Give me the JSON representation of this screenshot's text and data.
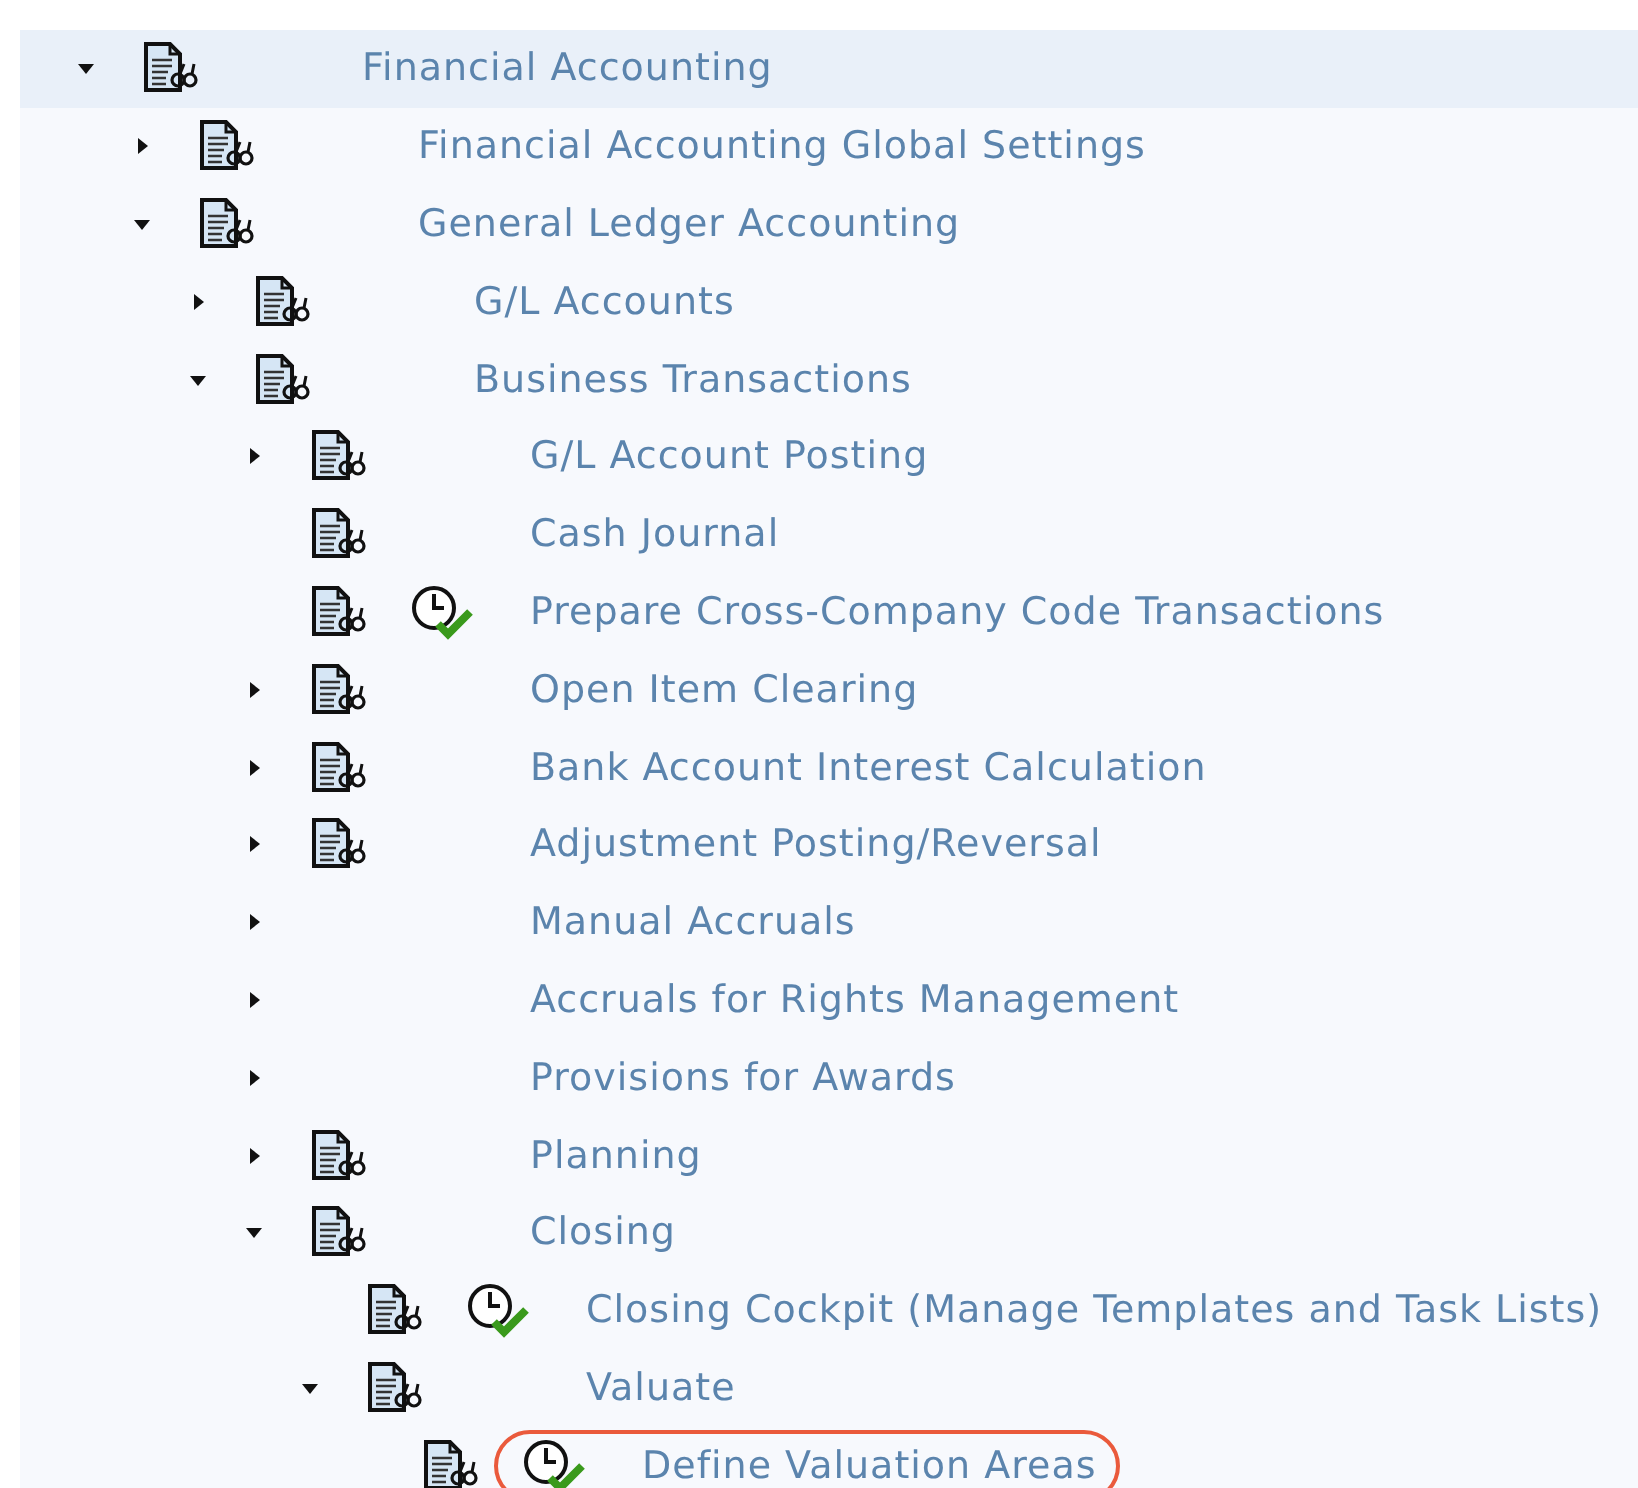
{
  "tree": [
    {
      "label": "Financial Accounting",
      "document": true,
      "activity": false,
      "expanded": true,
      "selected": true,
      "children": [
        {
          "label": "Financial Accounting Global Settings",
          "document": true,
          "activity": false,
          "expanded": false,
          "selected": false
        },
        {
          "label": "General Ledger Accounting",
          "document": true,
          "activity": false,
          "expanded": true,
          "selected": false,
          "children": [
            {
              "label": "G/L Accounts",
              "document": true,
              "activity": false,
              "expanded": false,
              "selected": false
            },
            {
              "label": "Business Transactions",
              "document": true,
              "activity": false,
              "expanded": true,
              "selected": false,
              "children": [
                {
                  "label": "G/L Account Posting",
                  "document": true,
                  "activity": false,
                  "expanded": false,
                  "selected": false
                },
                {
                  "label": "Cash Journal",
                  "document": true,
                  "activity": false,
                  "selected": false
                },
                {
                  "label": "Prepare Cross-Company Code Transactions",
                  "document": true,
                  "activity": true,
                  "selected": false
                },
                {
                  "label": "Open Item Clearing",
                  "document": true,
                  "activity": false,
                  "expanded": false,
                  "selected": false
                },
                {
                  "label": "Bank Account Interest Calculation",
                  "document": true,
                  "activity": false,
                  "expanded": false,
                  "selected": false
                },
                {
                  "label": "Adjustment Posting/Reversal",
                  "document": true,
                  "activity": false,
                  "expanded": false,
                  "selected": false
                },
                {
                  "label": "Manual Accruals",
                  "document": false,
                  "activity": false,
                  "expanded": false,
                  "selected": false
                },
                {
                  "label": "Accruals for Rights Management",
                  "document": false,
                  "activity": false,
                  "expanded": false,
                  "selected": false
                },
                {
                  "label": "Provisions for Awards",
                  "document": false,
                  "activity": false,
                  "expanded": false,
                  "selected": false
                },
                {
                  "label": "Planning",
                  "document": true,
                  "activity": false,
                  "expanded": false,
                  "selected": false
                },
                {
                  "label": "Closing",
                  "document": true,
                  "activity": false,
                  "expanded": true,
                  "selected": false,
                  "children": [
                    {
                      "label": "Closing Cockpit (Manage Templates and Task Lists)",
                      "document": true,
                      "activity": true,
                      "selected": false
                    },
                    {
                      "label": "Valuate",
                      "document": true,
                      "activity": false,
                      "expanded": true,
                      "selected": false,
                      "children": [
                        {
                          "label": "Define Valuation Areas",
                          "document": true,
                          "activity": true,
                          "selected": false,
                          "highlighted": true
                        }
                      ]
                    }
                  ]
                }
              ]
            }
          ]
        }
      ]
    }
  ]
}
